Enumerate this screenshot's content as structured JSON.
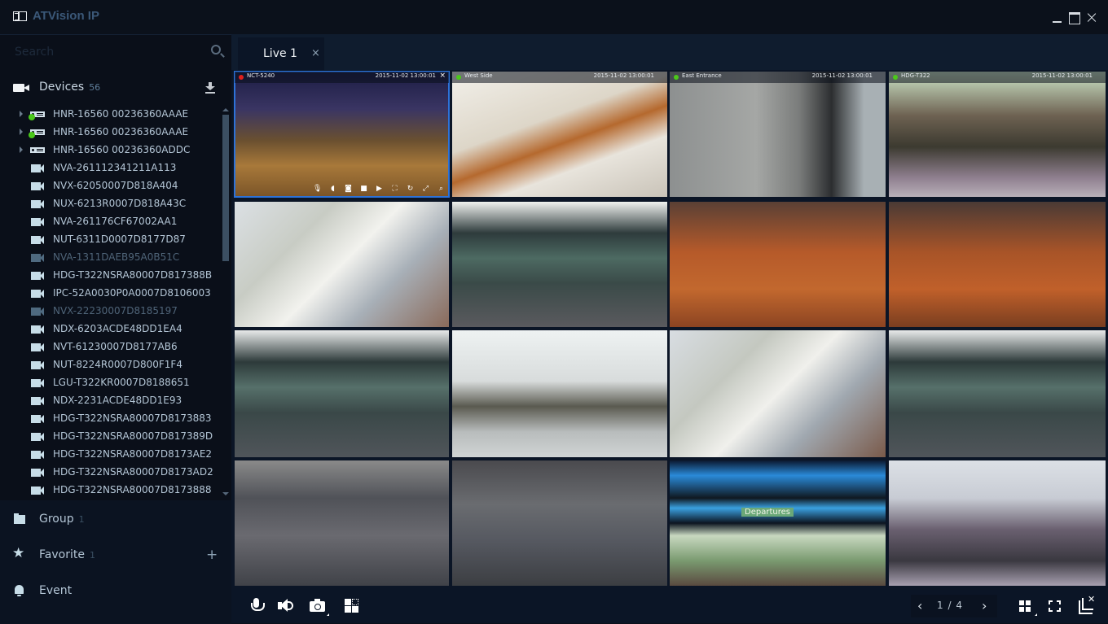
{
  "app": {
    "title": "ATVision IP",
    "window_controls": {
      "minimize": "minimize",
      "maximize": "maximize",
      "close": "close"
    }
  },
  "sidebar": {
    "search": {
      "placeholder": "Search",
      "value": ""
    },
    "devices_section": {
      "label": "Devices",
      "count": "56",
      "icon": "camera-icon",
      "action_icon": "download-icon"
    },
    "devices": [
      {
        "name": "HNR-16560 00236360AAAE",
        "type": "nvr",
        "expandable": true,
        "status": "online",
        "status_color": "#4bc81a"
      },
      {
        "name": "HNR-16560 00236360AAAE",
        "type": "nvr",
        "expandable": true,
        "status": "online",
        "status_color": "#4bc81a"
      },
      {
        "name": "HNR-16560 00236360ADDC",
        "type": "nvr",
        "expandable": true,
        "status": "none"
      },
      {
        "name": "NVA-261112341211A113",
        "type": "camera",
        "status": "online"
      },
      {
        "name": "NVX-62050007D818A404",
        "type": "camera",
        "status": "online"
      },
      {
        "name": "NUX-6213R0007D818A43C",
        "type": "camera",
        "status": "online"
      },
      {
        "name": "NVA-261176CF67002AA1",
        "type": "camera",
        "status": "online"
      },
      {
        "name": "NUT-6311D0007D8177D87",
        "type": "camera",
        "status": "online"
      },
      {
        "name": "NVA-1311DAEB95A0B51C",
        "type": "camera",
        "status": "offline"
      },
      {
        "name": "HDG-T322NSRA80007D817388B",
        "type": "camera",
        "status": "online"
      },
      {
        "name": "IPC-52A0030P0A0007D8106003",
        "type": "camera",
        "status": "online"
      },
      {
        "name": "NVX-22230007D8185197",
        "type": "camera",
        "status": "offline"
      },
      {
        "name": "NDX-6203ACDE48DD1EA4",
        "type": "camera",
        "status": "online"
      },
      {
        "name": "NVT-61230007D8177AB6",
        "type": "camera",
        "status": "online"
      },
      {
        "name": "NUT-8224R0007D800F1F4",
        "type": "camera",
        "status": "online"
      },
      {
        "name": "LGU-T322KR0007D8188651",
        "type": "camera",
        "status": "online"
      },
      {
        "name": "NDX-2231ACDE48DD1E93",
        "type": "camera",
        "status": "online"
      },
      {
        "name": "HDG-T322NSRA80007D8173883",
        "type": "camera",
        "status": "online"
      },
      {
        "name": "HDG-T322NSRA80007D817389D",
        "type": "camera",
        "status": "online"
      },
      {
        "name": "HDG-T322NSRA80007D8173AE2",
        "type": "camera",
        "status": "online"
      },
      {
        "name": "HDG-T322NSRA80007D8173AD2",
        "type": "camera",
        "status": "online"
      },
      {
        "name": "HDG-T322NSRA80007D8173888",
        "type": "camera",
        "status": "online"
      }
    ],
    "nav": [
      {
        "label": "Group",
        "count": "1",
        "icon": "folder-icon"
      },
      {
        "label": "Favorite",
        "count": "1",
        "icon": "star-icon",
        "action_icon": "plus-icon"
      },
      {
        "label": "Event",
        "count": "",
        "icon": "bell-icon"
      }
    ]
  },
  "main": {
    "tabs": [
      {
        "label": "Live 1",
        "close": "×",
        "active": true
      }
    ],
    "tiles": [
      {
        "camera": "NCT-5240",
        "timestamp": "2015-11-02 13:00:01",
        "status_color": "#e0201c",
        "selected": true,
        "scene": "railway-night",
        "close": "×",
        "tools": [
          "mic",
          "speaker",
          "snapshot",
          "record",
          "playback",
          "fit",
          "ptz",
          "fullscreen",
          "zoom"
        ]
      },
      {
        "camera": "West Side",
        "timestamp": "2015-11-02 13:00:01",
        "status_color": "#4bc81a",
        "scene": "atrium"
      },
      {
        "camera": "East Entrance",
        "timestamp": "2015-11-02 13:00:01",
        "status_color": "#4bc81a",
        "scene": "concrete-wall"
      },
      {
        "camera": "HDG-T322",
        "timestamp": "2015-11-02 13:00:01",
        "status_color": "#4bc81a",
        "scene": "warehouse"
      },
      {
        "scene": "meeting"
      },
      {
        "scene": "airport-checkin"
      },
      {
        "scene": "luggage-floor"
      },
      {
        "scene": "luggage-floor-2"
      },
      {
        "scene": "airport-checkin-2"
      },
      {
        "scene": "travelers"
      },
      {
        "scene": "meeting-2"
      },
      {
        "scene": "airport-checkin-3"
      },
      {
        "scene": "highway-traffic"
      },
      {
        "scene": "city-traffic"
      },
      {
        "scene": "departures-board",
        "sign": "Departures"
      },
      {
        "scene": "call-center"
      }
    ]
  },
  "footer": {
    "left_tools": [
      "mic-icon",
      "speaker-icon",
      "camera-icon",
      "layout-edit-icon"
    ],
    "pager": {
      "prev": "‹",
      "current": "1",
      "separator": "/",
      "total": "4",
      "next": "›"
    },
    "right_tools": [
      "grid-layout-icon",
      "fullscreen-icon",
      "close-all-icon"
    ]
  }
}
